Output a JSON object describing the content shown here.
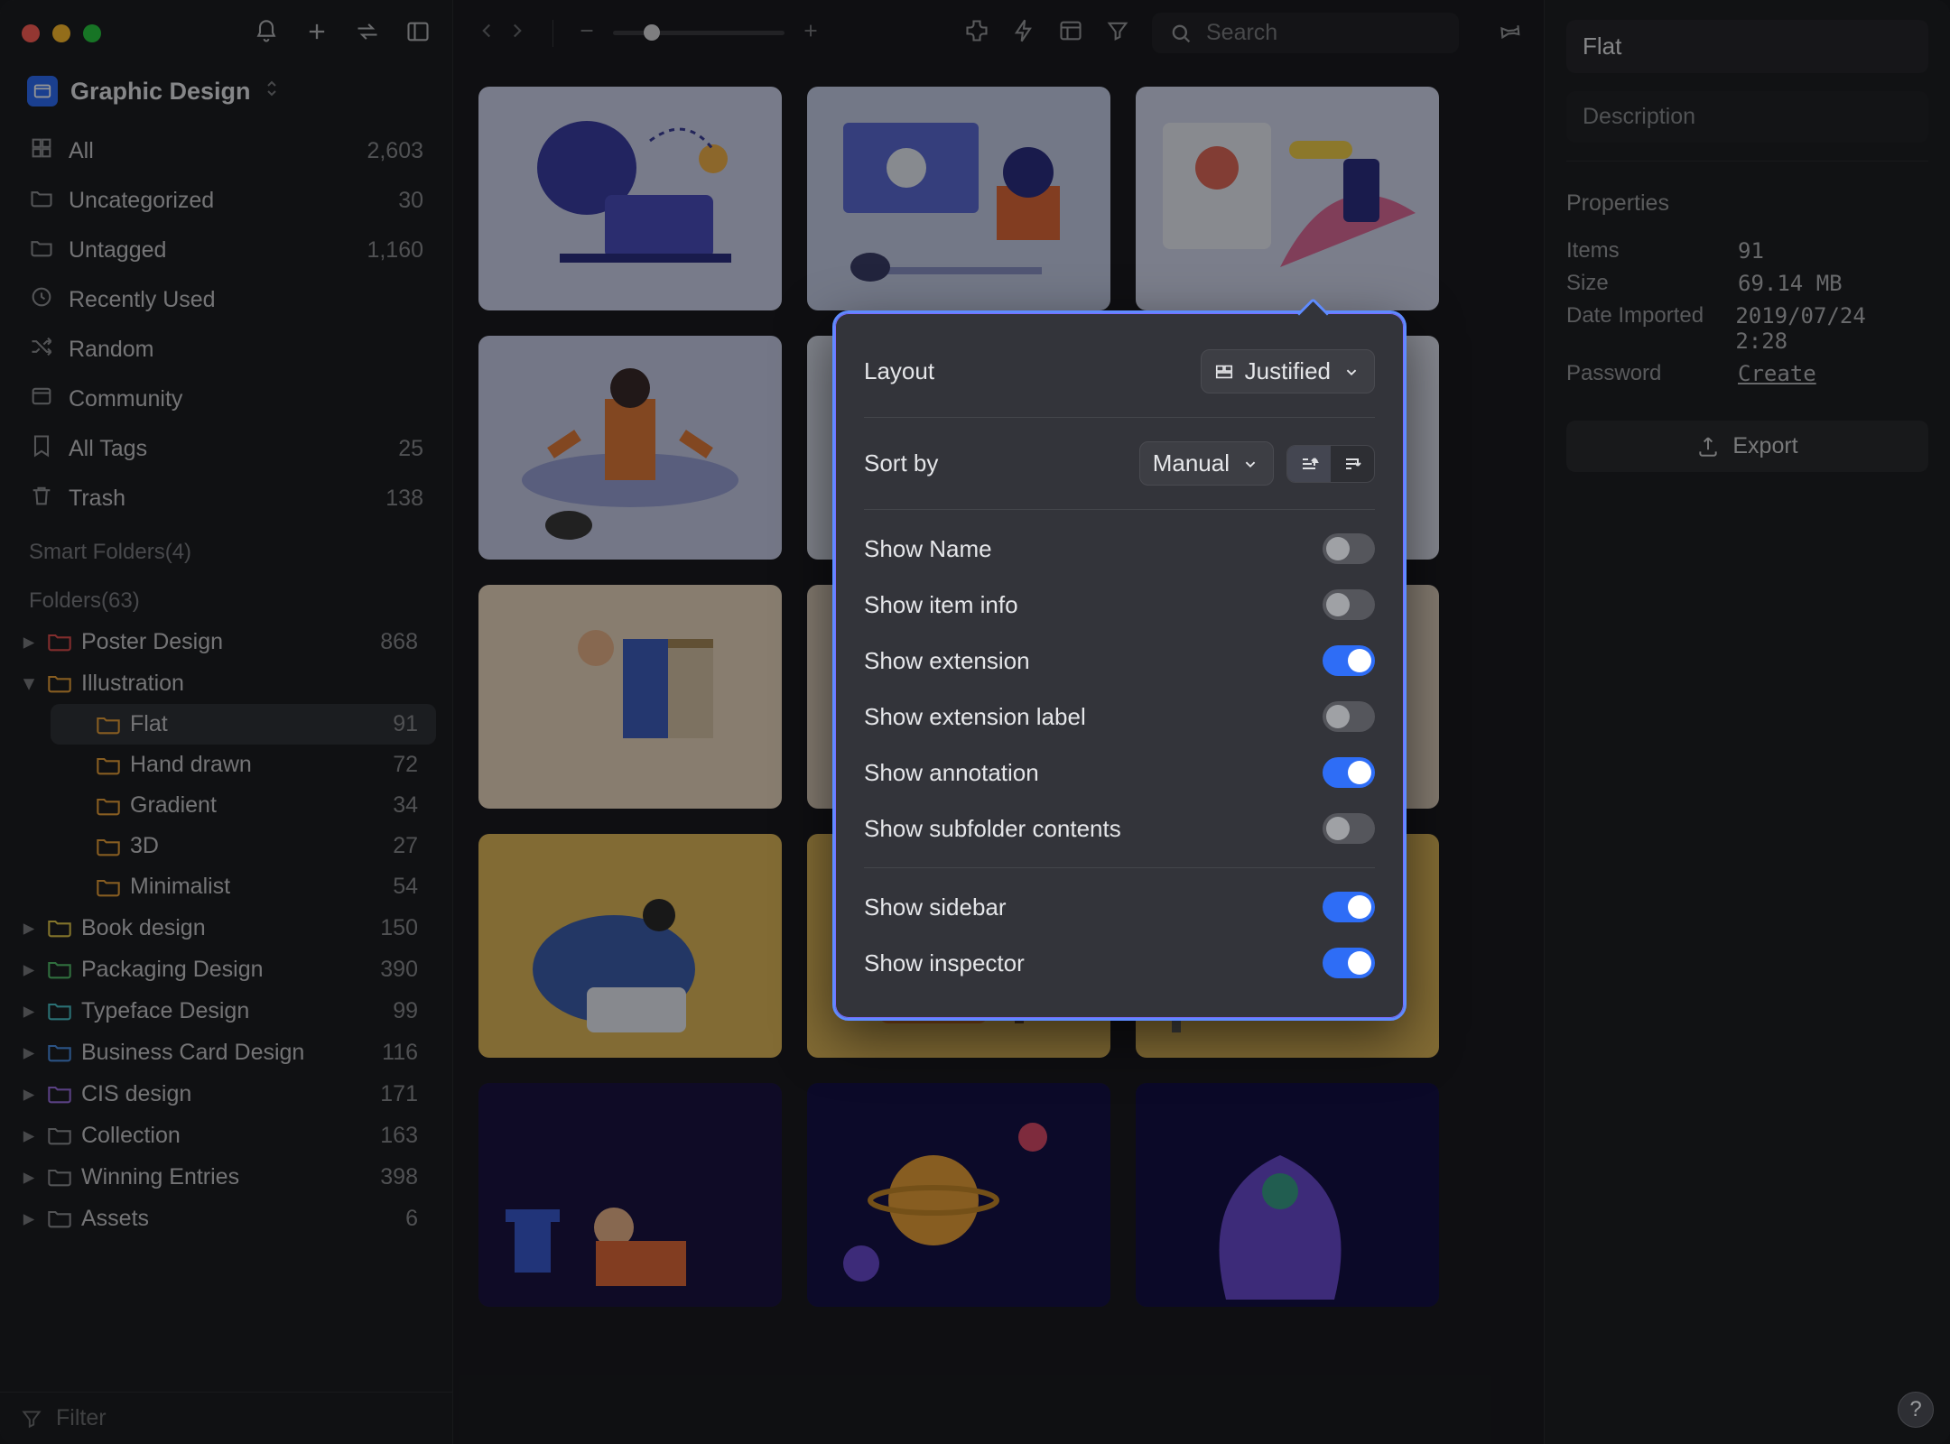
{
  "library": {
    "name": "Graphic Design"
  },
  "toolbar": {
    "search_placeholder": "Search"
  },
  "sidebar": {
    "items": [
      {
        "icon": "all",
        "label": "All",
        "count": "2,603"
      },
      {
        "icon": "uncat",
        "label": "Uncategorized",
        "count": "30"
      },
      {
        "icon": "untag",
        "label": "Untagged",
        "count": "1,160"
      },
      {
        "icon": "recent",
        "label": "Recently Used",
        "count": ""
      },
      {
        "icon": "random",
        "label": "Random",
        "count": ""
      },
      {
        "icon": "community",
        "label": "Community",
        "count": ""
      },
      {
        "icon": "tags",
        "label": "All Tags",
        "count": "25"
      },
      {
        "icon": "trash",
        "label": "Trash",
        "count": "138"
      }
    ],
    "smart_label": "Smart Folders(4)",
    "folders_label": "Folders(63)",
    "folders": [
      {
        "name": "Poster Design",
        "count": "868",
        "color": "#e04f4f",
        "expandable": true
      },
      {
        "name": "Illustration",
        "count": "",
        "color": "#e8a13a",
        "expandable": true,
        "expanded": true,
        "children": [
          {
            "name": "Flat",
            "count": "91",
            "active": true
          },
          {
            "name": "Hand drawn",
            "count": "72"
          },
          {
            "name": "Gradient",
            "count": "34"
          },
          {
            "name": "3D",
            "count": "27"
          },
          {
            "name": "Minimalist",
            "count": "54"
          }
        ]
      },
      {
        "name": "Book design",
        "count": "150",
        "color": "#e2c94a",
        "expandable": true
      },
      {
        "name": "Packaging Design",
        "count": "390",
        "color": "#54c06b",
        "expandable": true
      },
      {
        "name": "Typeface Design",
        "count": "99",
        "color": "#49c2c9",
        "expandable": true
      },
      {
        "name": "Business Card Design",
        "count": "116",
        "color": "#4b8fe6",
        "expandable": true
      },
      {
        "name": "CIS design",
        "count": "171",
        "color": "#9a6fe0",
        "expandable": true
      },
      {
        "name": "Collection",
        "count": "163",
        "color": "#8f9195",
        "expandable": true
      },
      {
        "name": "Winning Entries",
        "count": "398",
        "color": "#8f9195",
        "expandable": true
      },
      {
        "name": "Assets",
        "count": "6",
        "color": "#8f9195",
        "expandable": true,
        "truncated": true
      }
    ],
    "filter_placeholder": "Filter"
  },
  "inspector": {
    "title": "Flat",
    "description_placeholder": "Description",
    "section": "Properties",
    "props": [
      {
        "k": "Items",
        "v": "91"
      },
      {
        "k": "Size",
        "v": "69.14 MB"
      },
      {
        "k": "Date Imported",
        "v": "2019/07/24 2:28"
      },
      {
        "k": "Password",
        "v": "Create",
        "link": true
      }
    ],
    "export_label": "Export"
  },
  "popover": {
    "layout_label": "Layout",
    "layout_value": "Justified",
    "sort_label": "Sort by",
    "sort_value": "Manual",
    "toggles": [
      {
        "label": "Show Name",
        "on": false
      },
      {
        "label": "Show item info",
        "on": false
      },
      {
        "label": "Show extension",
        "on": true
      },
      {
        "label": "Show extension label",
        "on": false
      },
      {
        "label": "Show annotation",
        "on": true
      },
      {
        "label": "Show subfolder contents",
        "on": false
      }
    ],
    "toggles2": [
      {
        "label": "Show sidebar",
        "on": true
      },
      {
        "label": "Show inspector",
        "on": true
      }
    ]
  },
  "thumbs": [
    {
      "bg": "#cfd4ee"
    },
    {
      "bg": "#c7cfe8"
    },
    {
      "bg": "#d5d9ef"
    },
    {
      "bg": "#c9cee8"
    },
    {
      "bg": "#dfe3f2"
    },
    {
      "bg": "#e3e7f4"
    },
    {
      "bg": "#ead7c0"
    },
    {
      "bg": "#e2d3bf"
    },
    {
      "bg": "#e2d3bf"
    },
    {
      "bg": "#e1b95a"
    },
    {
      "bg": "#e1b95a"
    },
    {
      "bg": "#e1b95a"
    },
    {
      "bg": "#1a1442"
    },
    {
      "bg": "#151247"
    },
    {
      "bg": "#131045"
    }
  ]
}
